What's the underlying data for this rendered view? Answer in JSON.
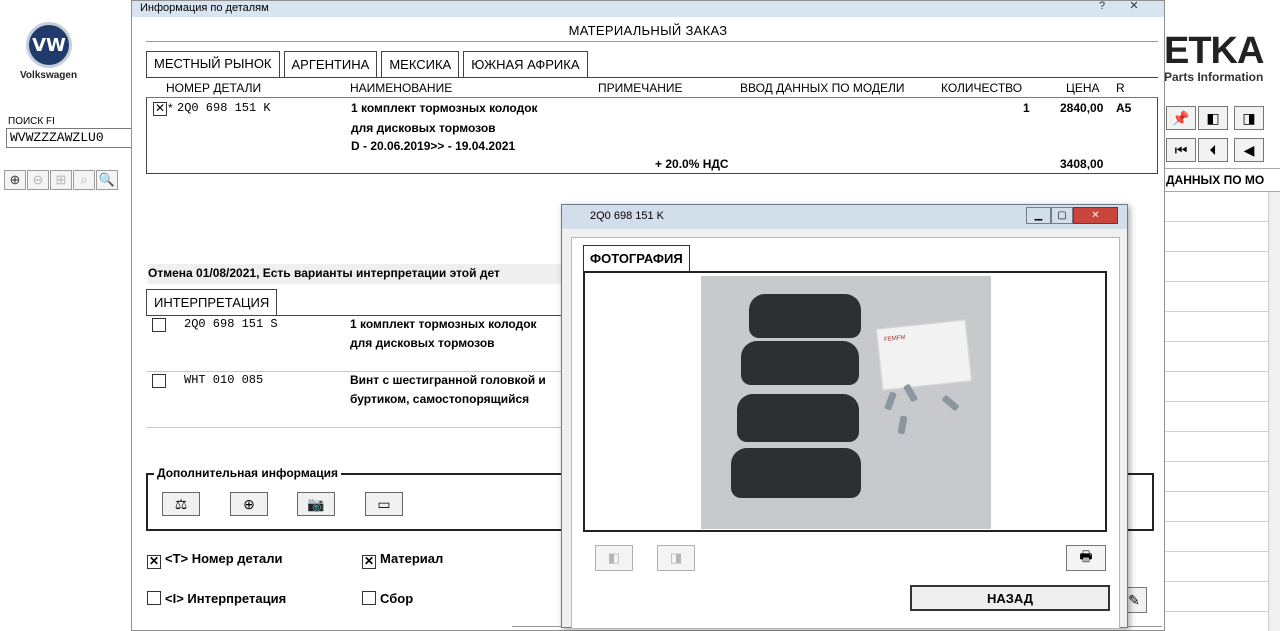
{
  "app": {
    "brand_name": "Volkswagen",
    "logo_mark": "VW",
    "etka_logo": "ETKA",
    "etka_subtitle": "Parts Information",
    "search_label": "ПОИСК FI",
    "search_value": "WVWZZZAWZLU0",
    "right_column_header": "ДАННЫХ ПО МО"
  },
  "main_window": {
    "title": "Информация по деталям",
    "help_label": "?",
    "close_label": "✕",
    "order_title": "МАТЕРИАЛЬНЫЙ ЗАКАЗ",
    "tabs": [
      {
        "label": "МЕСТНЫЙ РЫНОК",
        "active": true
      },
      {
        "label": "АРГЕНТИНА",
        "active": false
      },
      {
        "label": "МЕКСИКА",
        "active": false
      },
      {
        "label": "ЮЖНАЯ АФРИКА",
        "active": false
      }
    ],
    "columns": {
      "part_no": "НОМЕР ДЕТАЛИ",
      "name": "НАИМЕНОВАНИЕ",
      "note": "ПРИМЕЧАНИЕ",
      "model_input": "ВВОД ДАННЫХ ПО МОДЕЛИ",
      "quantity": "КОЛИЧЕСТВО",
      "price": "ЦЕНА",
      "r": "R"
    },
    "order_row": {
      "checked": true,
      "marker": "*",
      "part_no": "2Q0 698 151 K",
      "name_line1": "1 комплект тормозных колодок",
      "name_line2": "для дисковых тормозов",
      "dates": "D - 20.06.2019>> - 19.04.2021",
      "quantity": "1",
      "price": "2840,00",
      "r": "A5",
      "vat_label": "+ 20.0% НДС",
      "vat_price": "3408,00"
    },
    "cancel_note": "Отмена 01/08/2021, Есть варианты интерпретации этой дет",
    "interpretation_tab": "ИНТЕРПРЕТАЦИЯ",
    "interpretation_rows": [
      {
        "part_no": "2Q0 698 151 S",
        "line1": "1 комплект тормозных колодок",
        "line2": "для дисковых тормозов",
        "checked": false
      },
      {
        "part_no": "WHT 010 085",
        "line1": "Винт с шестигранной головкой и",
        "line2": "буртиком, самостопорящийся",
        "checked": false
      }
    ],
    "additional_info": {
      "legend": "Дополнительная информация",
      "icons": [
        "scale-icon",
        "add-part-icon",
        "camera-icon",
        "frame-icon"
      ]
    },
    "options": {
      "part_number": {
        "label": "<T> Номер детали",
        "checked": true
      },
      "material": {
        "label": "Материал",
        "checked": true
      },
      "interpretation": {
        "label": "<I> Интерпретация",
        "checked": false
      },
      "assembly": {
        "label": "Сбор",
        "checked": false
      }
    }
  },
  "photo_window": {
    "title": "2Q0 698 151 K",
    "tab": "ФОТОГРАФИЯ",
    "paper_label": "FEMFM",
    "back_button": "НАЗАД"
  }
}
